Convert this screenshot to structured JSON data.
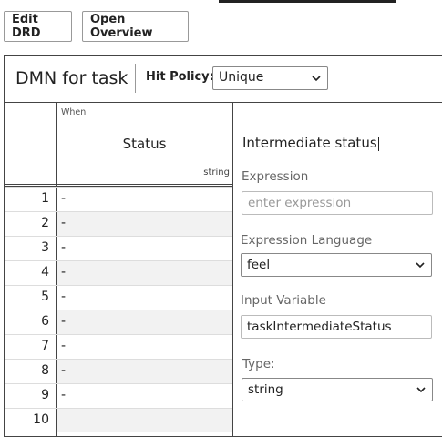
{
  "toolbar": {
    "edit_drd": "Edit DRD",
    "open_overview": "Open Overview"
  },
  "header": {
    "title": "DMN for task",
    "hit_policy_label": "Hit Policy:",
    "hit_policy_value": "Unique"
  },
  "input_column": {
    "clause": "When",
    "label": "Status",
    "type": "string"
  },
  "rows": [
    {
      "num": "1",
      "value": "-"
    },
    {
      "num": "2",
      "value": "-"
    },
    {
      "num": "3",
      "value": "-"
    },
    {
      "num": "4",
      "value": "-"
    },
    {
      "num": "5",
      "value": "-"
    },
    {
      "num": "6",
      "value": "-"
    },
    {
      "num": "7",
      "value": "-"
    },
    {
      "num": "8",
      "value": "-"
    },
    {
      "num": "9",
      "value": "-"
    },
    {
      "num": "10",
      "value": ""
    }
  ],
  "panel": {
    "title": "Intermediate status",
    "expression_label": "Expression",
    "expression_placeholder": "enter expression",
    "language_label": "Expression Language",
    "language_value": "feel",
    "input_variable_label": "Input Variable",
    "input_variable_value": "taskIntermediateStatus",
    "type_label": "Type:",
    "type_value": "string"
  }
}
